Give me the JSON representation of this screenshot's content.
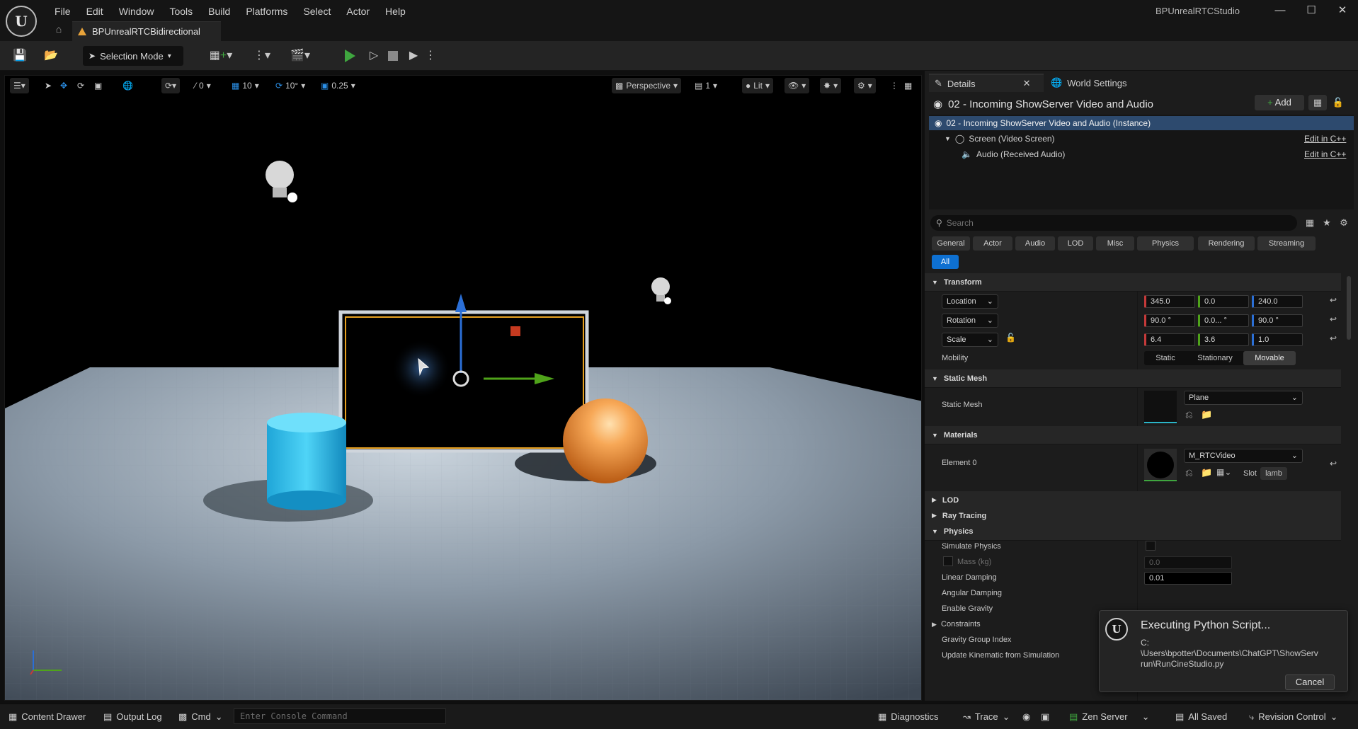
{
  "menu": [
    "File",
    "Edit",
    "Window",
    "Tools",
    "Build",
    "Platforms",
    "Select",
    "Actor",
    "Help"
  ],
  "app_title": "BPUnrealRTCStudio",
  "document_tab": "BPUnrealRTCBidirectional",
  "toolbar": {
    "selection_mode": "Selection Mode"
  },
  "viewport_toolbar": {
    "rotate_snap_value": "0",
    "grid_snap_value": "10",
    "angle_snap_value": "10°",
    "scale_snap_value": "0.25",
    "view_mode": "Perspective",
    "camera_speed": "1",
    "lighting": "Lit"
  },
  "details": {
    "tab_details": "Details",
    "tab_world_settings": "World Settings",
    "actor_name": "02 - Incoming ShowServer Video and Audio",
    "add_label": "Add",
    "components": [
      {
        "label": "02 - Incoming ShowServer Video and Audio (Instance)",
        "edit": ""
      },
      {
        "label": "Screen (Video Screen)",
        "edit": "Edit in C++"
      },
      {
        "label": "Audio (Received Audio)",
        "edit": "Edit in C++"
      }
    ],
    "search_placeholder": "Search",
    "filters": [
      "General",
      "Actor",
      "Audio",
      "LOD",
      "Misc",
      "Physics",
      "Rendering",
      "Streaming"
    ],
    "filter_all": "All",
    "transform": {
      "header": "Transform",
      "location_label": "Location",
      "location": [
        "345.0",
        "0.0",
        "240.0"
      ],
      "rotation_label": "Rotation",
      "rotation": [
        "90.0 °",
        "0.0... °",
        "90.0 °"
      ],
      "scale_label": "Scale",
      "scale": [
        "6.4",
        "3.6",
        "1.0"
      ],
      "mobility_label": "Mobility",
      "mobility_options": [
        "Static",
        "Stationary",
        "Movable"
      ]
    },
    "static_mesh": {
      "header": "Static Mesh",
      "label": "Static Mesh",
      "value": "Plane"
    },
    "materials": {
      "header": "Materials",
      "label": "Element 0",
      "value": "M_RTCVideo",
      "slot_label": "Slot",
      "slot_value": "lamb"
    },
    "lod": "LOD",
    "ray_tracing": "Ray Tracing",
    "physics": {
      "header": "Physics",
      "simulate": "Simulate Physics",
      "mass": "Mass (kg)",
      "mass_value": "0.0",
      "linear_damping": "Linear Damping",
      "linear_damping_value": "0.01",
      "angular_damping": "Angular Damping",
      "enable_gravity": "Enable Gravity",
      "constraints": "Constraints",
      "gravity_group": "Gravity Group Index",
      "update_kinematic": "Update Kinematic from Simulation"
    }
  },
  "statusbar": {
    "content_drawer": "Content Drawer",
    "output_log": "Output Log",
    "cmd": "Cmd",
    "console_placeholder": "Enter Console Command",
    "diagnostics": "Diagnostics",
    "trace": "Trace",
    "zen_server": "Zen Server",
    "all_saved": "All Saved",
    "revision_control": "Revision Control"
  },
  "popup": {
    "title": "Executing Python Script...",
    "path": "C:\\Users\\bpotter\\Documents\\ChatGPT\\ShowServrun\\RunCineStudio.py",
    "path_line1": "C:",
    "path_line2": "\\Users\\bpotter\\Documents\\ChatGPT\\ShowServ",
    "path_line3": "run\\RunCineStudio.py",
    "cancel": "Cancel"
  },
  "colors": {
    "accent": "#0e70d1",
    "play": "#3fa63f",
    "x_axis": "#c63a3a",
    "y_axis": "#4fa31a",
    "z_axis": "#2b6fd6"
  }
}
